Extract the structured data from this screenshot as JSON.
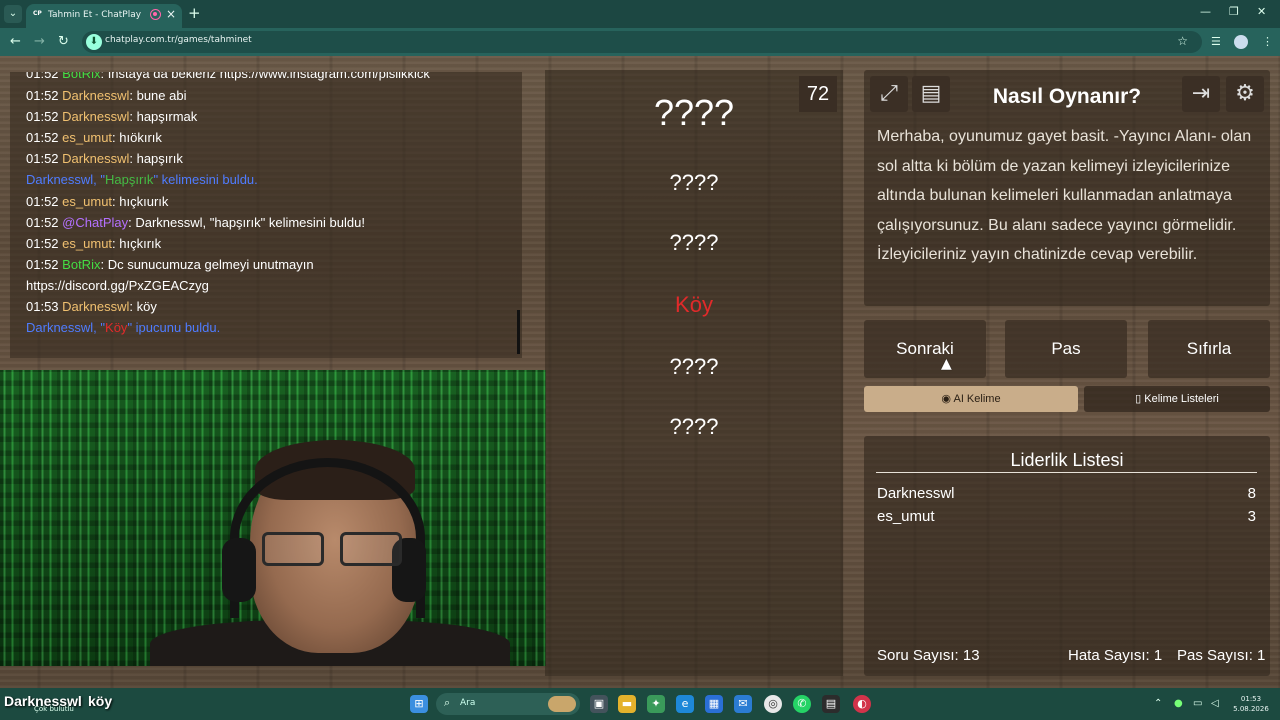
{
  "browser": {
    "tab_title": "Tahmin Et - ChatPlay",
    "tab_favicon": "CP",
    "url": "chatplay.com.tr/games/tahminet"
  },
  "chat": {
    "lines": [
      {
        "time": "01:52",
        "user": "BotRix",
        "text": ": İnstaya da bekleriz https://www.instagram.com/pislikkick"
      },
      {
        "time": "01:52",
        "user": "Darknesswl",
        "text": ": bune abi"
      },
      {
        "time": "01:52",
        "user": "Darknesswl",
        "text": ": hapşırmak"
      },
      {
        "time": "01:52",
        "user": "es_umut",
        "text": ": hıökırık"
      },
      {
        "time": "01:52",
        "user": "Darknesswl",
        "text": ": hapşırık"
      },
      {
        "time": "01:52",
        "user": "es_umut",
        "text": ": hıçkıurık"
      },
      {
        "time": "01:52",
        "user": "@ChatPlay",
        "text": ": Darknesswl, \"hapşırık\" kelimesini buldu!"
      },
      {
        "time": "01:52",
        "user": "es_umut",
        "text": ": hıçkırık"
      },
      {
        "time": "01:52",
        "user": "BotRix",
        "text": ": Dc sunucumuza gelmeyi unutmayın"
      },
      {
        "time": "",
        "user": "",
        "text": "https://discord.gg/PxZGEACzyg"
      },
      {
        "time": "01:53",
        "user": "Darknesswl",
        "text": ": köy"
      }
    ],
    "system1": {
      "a": "Darknesswl, \"",
      "word": "Hapşırık",
      "b": "\" kelimesini buldu."
    },
    "system2": {
      "a": "Darknesswl, \"",
      "word": "Köy",
      "b": "\" ipucunu buldu."
    }
  },
  "game": {
    "timer": "72",
    "target": "????",
    "hints": [
      "????",
      "????",
      "Köy",
      "????",
      "????"
    ]
  },
  "how_to_play": {
    "title": "Nasıl Oynanır?",
    "text": "Merhaba, oyunumuz gayet basit. -Yayıncı Alanı- olan sol altta ki bölüm de yazan kelimeyi izleyicilerinize altında bulunan kelimeleri kullanmadan anlatmaya çalışıyorsunuz. Bu alanı sadece yayıncı görmelidir. İzleyicileriniz yayın chatinizde cevap verebilir."
  },
  "controls": {
    "next": "Sonraki",
    "pass": "Pas",
    "reset": "Sıfırla",
    "ai_word": "AI Kelime",
    "word_lists": "Kelime Listeleri"
  },
  "leaderboard": {
    "title": "Liderlik Listesi",
    "entries": [
      {
        "name": "Darknesswl",
        "score": "8"
      },
      {
        "name": "es_umut",
        "score": "3"
      }
    ],
    "questions": "Soru Sayısı: 13",
    "errors": "Hata Sayısı: 1",
    "passes": "Pas Sayısı: 1"
  },
  "overlay": {
    "name": "Darknesswl",
    "word": "köy",
    "sub": "Çok bulutlu"
  },
  "taskbar": {
    "search_placeholder": "Ara",
    "time": "01:53",
    "date": "5.08.2026"
  },
  "colors": {
    "accent": "#1c4742",
    "user_orange": "#f0c070",
    "user_green": "#44dd44",
    "user_purple": "#b470ff",
    "system_blue": "#4f7cff",
    "hint_red": "#e12a2a"
  }
}
